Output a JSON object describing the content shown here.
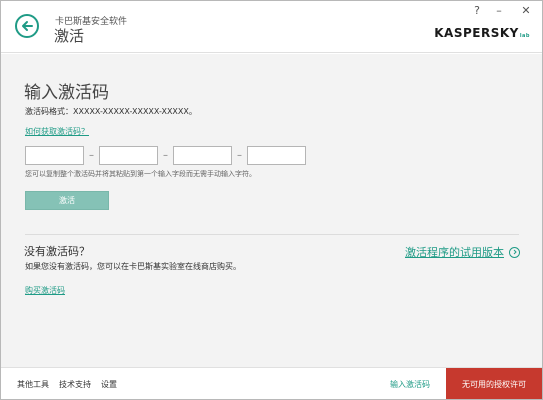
{
  "window": {
    "help_label": "?",
    "minimize_label": "–",
    "close_label": "✕"
  },
  "header": {
    "app_name": "卡巴斯基安全软件",
    "page_heading": "激活",
    "brand": "KASPERSKY",
    "brand_suffix": "lab"
  },
  "activation": {
    "title": "输入激活码",
    "format_line": "激活码格式：XXXXX-XXXXX-XXXXX-XXXXX。",
    "help_link": "如何获取激活码？",
    "inputs": [
      "",
      "",
      "",
      ""
    ],
    "paste_hint": "您可以复制整个激活码并将其粘贴到第一个输入字段而无需手动输入字符。",
    "activate_button": "激活"
  },
  "no_code": {
    "title": "没有激活码？",
    "description": "如果您没有激活码，您可以在卡巴斯基实验室在线商店购买。",
    "buy_link": "购买激活码",
    "trial_link": "激活程序的试用版本"
  },
  "footer": {
    "links": [
      "其他工具",
      "技术支持",
      "设置"
    ],
    "enter_code": "输入激活码",
    "no_license": "无可用的授权许可"
  },
  "colors": {
    "accent": "#1f9b86",
    "activate_disabled": "#85c2b6",
    "license_alert": "#c6392e"
  }
}
